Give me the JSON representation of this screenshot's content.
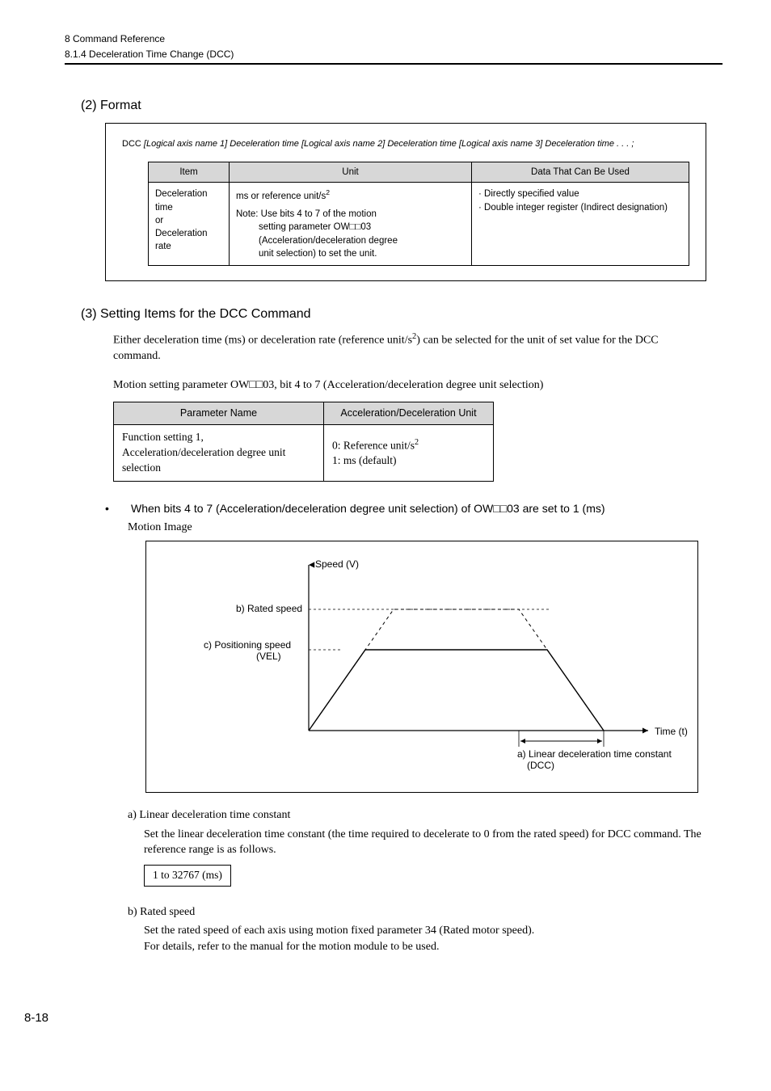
{
  "header": {
    "chapter": "8  Command Reference",
    "section": "8.1.4  Deceleration Time Change (DCC)"
  },
  "sec2": {
    "title": "(2) Format",
    "dccPrefix": "DCC",
    "dccLine": "  [Logical axis name 1] Deceleration time  [Logical axis name 2] Deceleration time  [Logical axis name 3] Deceleration time . . . ;",
    "thItem": "Item",
    "thUnit": "Unit",
    "thData": "Data That Can Be Used",
    "c1": "Deceleration time\nor\nDeceleration rate",
    "c2a": "ms or reference unit/s",
    "c2sup": "2",
    "c2note": "Note: Use bits 4 to 7 of the motion setting parameter OW□□03 (Acceleration/deceleration degree unit selection) to set the unit.",
    "c3a": "· Directly specified value",
    "c3b": "· Double integer register (Indirect designation)"
  },
  "sec3": {
    "title": "(3) Setting Items for the DCC Command",
    "p1a": "Either deceleration time (ms) or deceleration rate (reference unit/s",
    "p1sup": "2",
    "p1b": ") can be selected for the unit of set value for the DCC command.",
    "p2": "Motion setting parameter OW□□03, bit 4 to 7 (Acceleration/deceleration degree unit selection)",
    "thName": "Parameter Name",
    "thAccel": "Acceleration/Deceleration Unit",
    "tdName": "Function setting 1,\nAcceleration/deceleration degree unit selection",
    "tdAccel0a": "0: Reference unit/s",
    "tdAccel0sup": "2",
    "tdAccel1": "1: ms (default)"
  },
  "bullet": {
    "text": "When bits 4 to 7 (Acceleration/deceleration degree unit selection) of OW□□03 are set to 1 (ms)",
    "motion": "Motion Image"
  },
  "chart_data": {
    "type": "line",
    "title": "",
    "xlabel": "Time (t)",
    "ylabel": "Speed (V)",
    "annotations": {
      "y_top": "b) Rated speed",
      "y_mid": "c) Positioning speed (VEL)",
      "arrow_label": "a) Linear deceleration time constant (DCC)"
    },
    "series": [
      {
        "name": "dashed-rated-profile",
        "style": "dashed",
        "points": [
          [
            0,
            0
          ],
          [
            140,
            180
          ],
          [
            370,
            180
          ],
          [
            510,
            0
          ]
        ]
      },
      {
        "name": "solid-positioning-profile",
        "style": "solid",
        "points": [
          [
            0,
            0
          ],
          [
            95,
            120
          ],
          [
            415,
            120
          ],
          [
            510,
            0
          ]
        ]
      }
    ],
    "decel_interval_x": [
      370,
      510
    ]
  },
  "subA": {
    "label": "a) Linear deceleration time constant",
    "desc": "Set the linear deceleration time constant (the time required to decelerate to 0 from the rated speed) for DCC command. The reference range is as follows.",
    "range": "1 to 32767 (ms)"
  },
  "subB": {
    "label": "b) Rated speed",
    "desc1": "Set the rated speed of each axis using motion fixed parameter 34 (Rated motor speed).",
    "desc2": "For details, refer to the manual for the motion module to be used."
  },
  "pageNum": "8-18"
}
